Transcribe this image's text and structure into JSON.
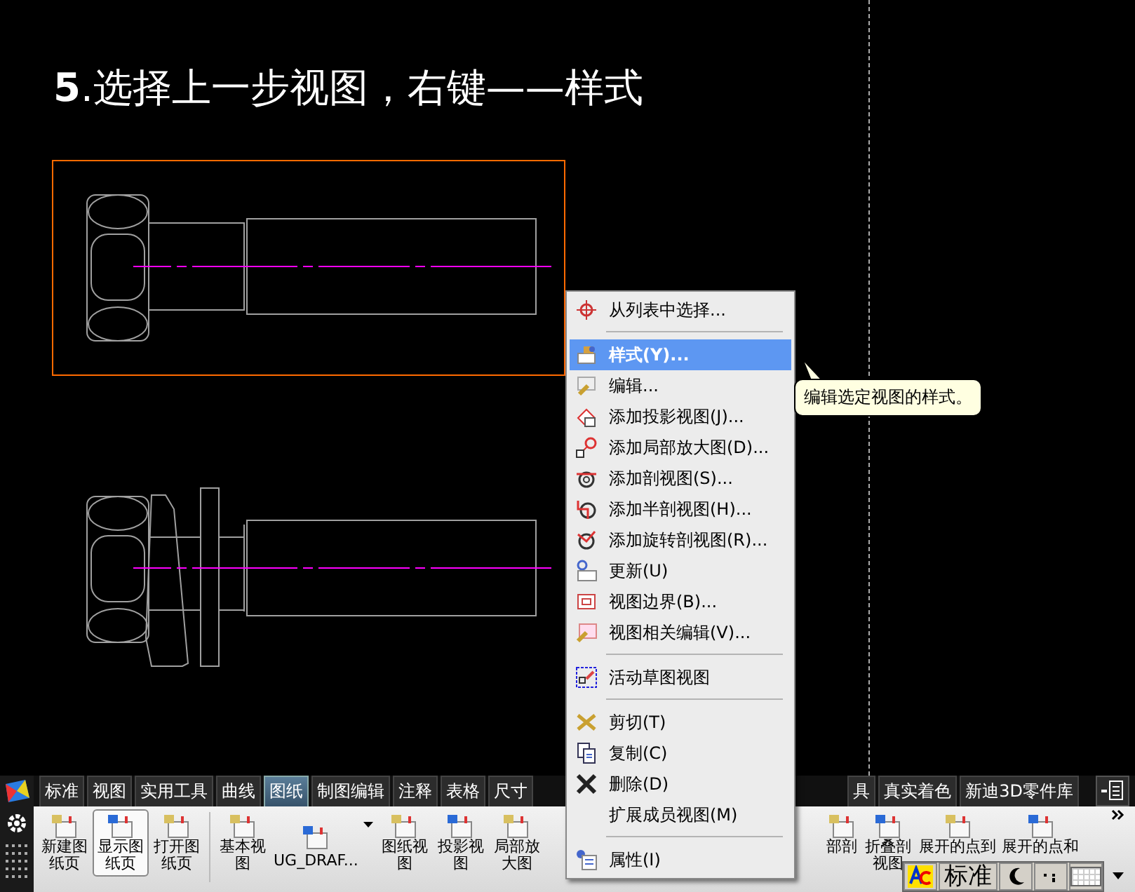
{
  "title": "**5**.选择上一步视图，右键——样式",
  "views": [
    {
      "selected": true
    },
    {
      "selected": false
    }
  ],
  "context_menu": {
    "items": [
      {
        "kind": "item",
        "label": "从列表中选择...",
        "selected": false
      },
      {
        "kind": "separator"
      },
      {
        "kind": "item",
        "label": "样式(Y)...",
        "selected": true
      },
      {
        "kind": "item",
        "label": "编辑...",
        "selected": false
      },
      {
        "kind": "item",
        "label": "添加投影视图(J)...",
        "selected": false
      },
      {
        "kind": "item",
        "label": "添加局部放大图(D)...",
        "selected": false
      },
      {
        "kind": "item",
        "label": "添加剖视图(S)...",
        "selected": false
      },
      {
        "kind": "item",
        "label": "添加半剖视图(H)...",
        "selected": false
      },
      {
        "kind": "item",
        "label": "添加旋转剖视图(R)...",
        "selected": false
      },
      {
        "kind": "item",
        "label": "更新(U)",
        "selected": false
      },
      {
        "kind": "item",
        "label": "视图边界(B)...",
        "selected": false
      },
      {
        "kind": "item",
        "label": "视图相关编辑(V)...",
        "selected": false
      },
      {
        "kind": "separator"
      },
      {
        "kind": "item",
        "label": "活动草图视图",
        "selected": false
      },
      {
        "kind": "separator"
      },
      {
        "kind": "item",
        "label": "剪切(T)",
        "selected": false
      },
      {
        "kind": "item",
        "label": "复制(C)",
        "selected": false
      },
      {
        "kind": "item",
        "label": "删除(D)",
        "selected": false
      },
      {
        "kind": "item",
        "label": "扩展成员视图(M)",
        "selected": false
      },
      {
        "kind": "separator"
      },
      {
        "kind": "item",
        "label": "属性(I)",
        "selected": false
      }
    ]
  },
  "tooltip": "编辑选定视图的样式。",
  "toolbar": {
    "tabs_left": [
      {
        "label": "标准",
        "selected": false
      },
      {
        "label": "视图",
        "selected": false
      },
      {
        "label": "实用工具",
        "selected": false
      },
      {
        "label": "曲线",
        "selected": false
      },
      {
        "label": "图纸",
        "selected": true
      },
      {
        "label": "制图编辑",
        "selected": false
      },
      {
        "label": "注释",
        "selected": false
      },
      {
        "label": "表格",
        "selected": false
      },
      {
        "label": "尺寸",
        "selected": false
      }
    ],
    "tabs_right": [
      {
        "label": "具",
        "selected": false
      },
      {
        "label": "真实着色",
        "selected": false
      },
      {
        "label": "新迪3D零件库",
        "selected": false
      }
    ],
    "ribbon_left": [
      {
        "kind": "button",
        "label": "新建图纸页",
        "selected": false
      },
      {
        "kind": "button",
        "label": "显示图纸页",
        "selected": true
      },
      {
        "kind": "button",
        "label": "打开图纸页",
        "selected": false
      },
      {
        "kind": "separator"
      },
      {
        "kind": "button",
        "label": "基本视图",
        "selected": false
      },
      {
        "kind": "dropdown",
        "label": "UG_DRAF...",
        "selected": false
      },
      {
        "kind": "button",
        "label": "图纸视图",
        "selected": false
      },
      {
        "kind": "button",
        "label": "投影视图",
        "selected": false
      },
      {
        "kind": "button",
        "label": "局部放大图",
        "selected": false
      }
    ],
    "ribbon_right": [
      {
        "kind": "button",
        "label": "部剖",
        "selected": false
      },
      {
        "kind": "button",
        "label": "折叠剖视图",
        "selected": false
      },
      {
        "kind": "button",
        "label": "展开的点到",
        "selected": false
      },
      {
        "kind": "button",
        "label": "展开的点和",
        "selected": false
      }
    ]
  },
  "ime_bar": {
    "mode": "标准"
  }
}
